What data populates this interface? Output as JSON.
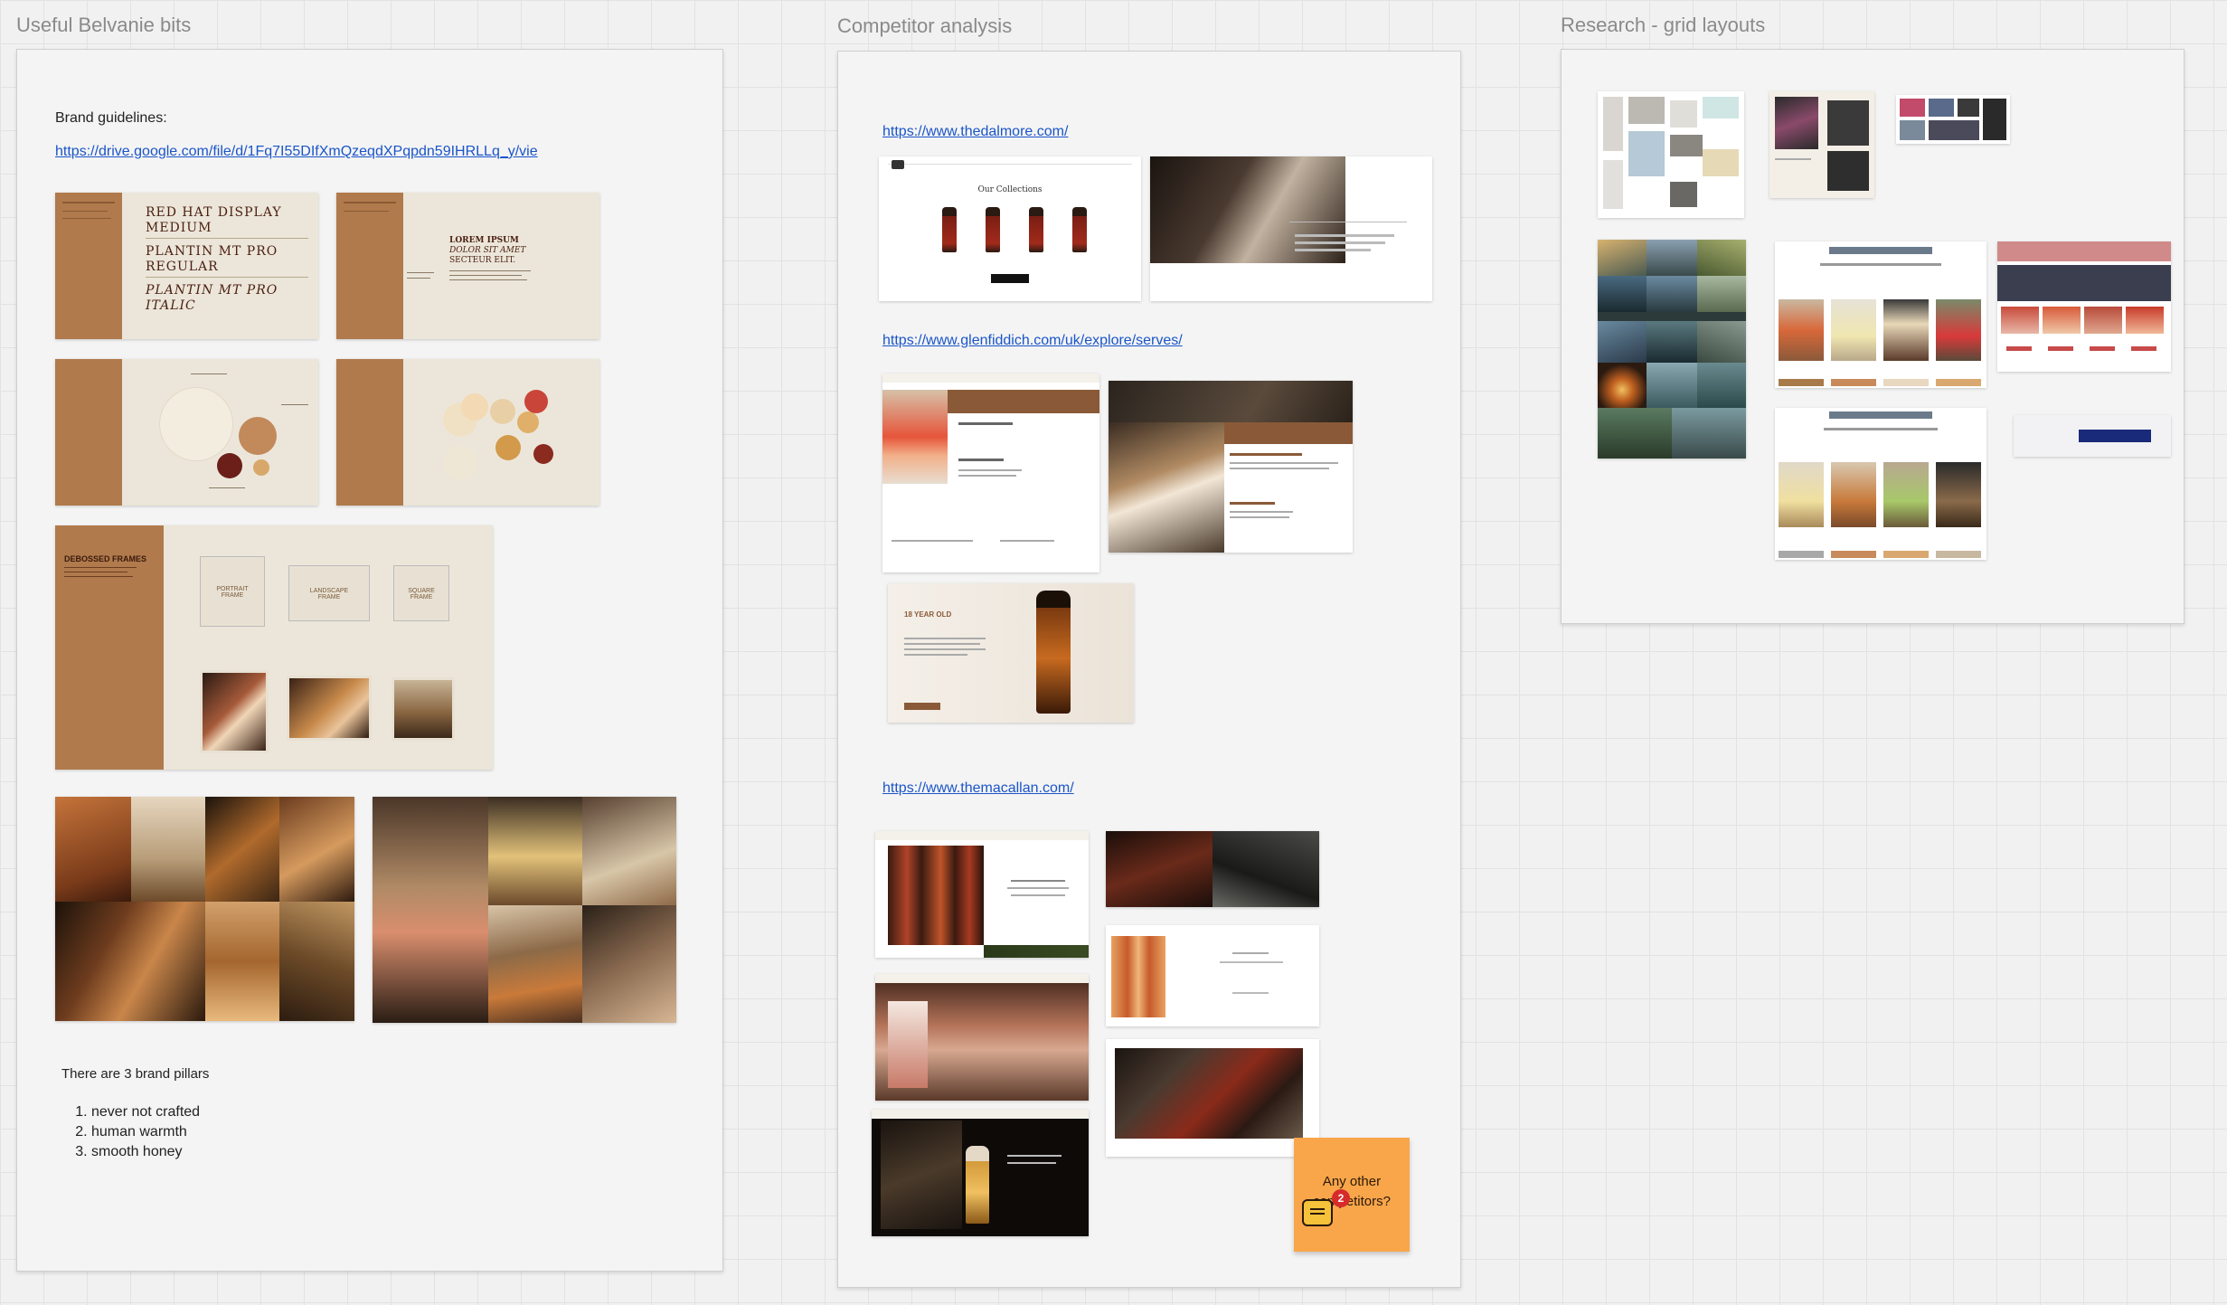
{
  "frames": {
    "belvanie": {
      "title": "Useful Belvanie bits",
      "brand_label": "Brand guidelines:",
      "brand_link": "https://drive.google.com/file/d/1Fq7I55DIfXmQzeqdXPqpdn59IHRLLq_y/vie",
      "typo_lines": [
        "RED HAT DISPLAY",
        "MEDIUM",
        "PLANTIN MT PRO",
        "REGULAR",
        "PLANTIN MT PRO",
        "ITALIC"
      ],
      "lorem_lines": [
        "LOREM IPSUM",
        "DOLOR SIT AMET",
        "SECTEUR ELIT."
      ],
      "frames_title": "DEBOSSED FRAMES",
      "frames_labels": [
        "PORTRAIT FRAME",
        "LANDSCAPE FRAME",
        "SQUARE FRAME"
      ],
      "pillars_intro": "There are 3 brand pillars",
      "pillars": [
        "never not crafted",
        "human warmth",
        "smooth honey"
      ]
    },
    "competitor": {
      "title": "Competitor analysis",
      "links": [
        "https://www.thedalmore.com/",
        "https://www.glenfiddich.com/uk/explore/serves/",
        "https://www.themacallan.com/"
      ],
      "dalmore_heading": "Our Collections",
      "glenfiddich_age": "18 YEAR OLD"
    },
    "research": {
      "title": "Research - grid layouts"
    }
  },
  "sticky": {
    "text": "Any other competitors?",
    "comment_count": "2"
  },
  "colors": {
    "canvas": "#f1f1f1",
    "frame": "#f4f4f4",
    "brand_tan": "#b07a4c",
    "link": "#1a55c8",
    "sticky": "#f9a64a",
    "badge": "#d62b2b"
  }
}
